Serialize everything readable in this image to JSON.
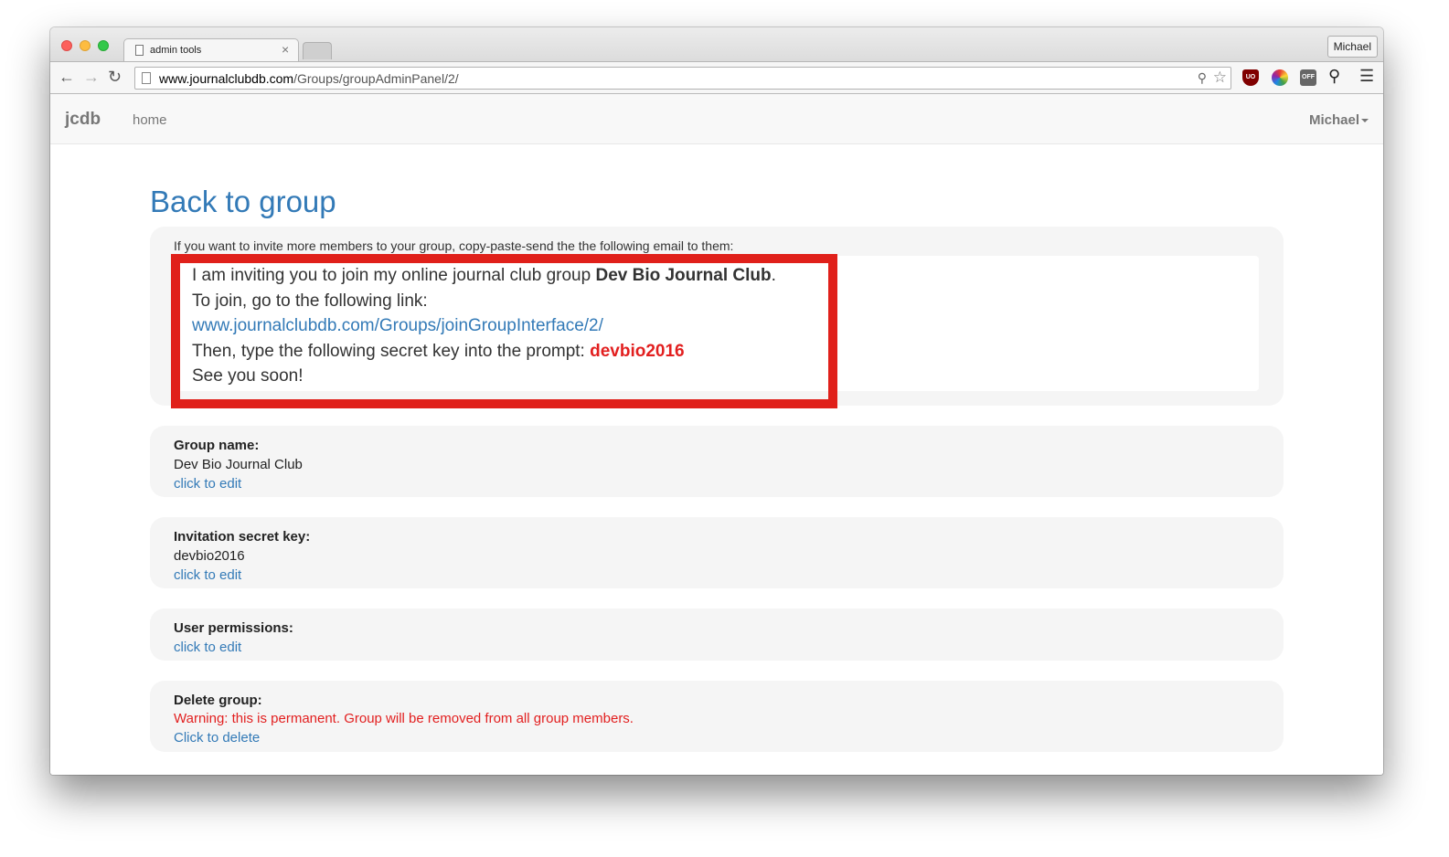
{
  "browser": {
    "tab_title": "admin tools",
    "tab_close": "×",
    "profile_name": "Michael",
    "url_host": "www.journalclubdb.com",
    "url_path": "/Groups/groupAdminPanel/2/",
    "ext_ublock_label": "UO",
    "ext_off_label": "OFF"
  },
  "navbar": {
    "brand": "jcdb",
    "home": "home",
    "user": "Michael"
  },
  "main": {
    "back_link": "Back to group",
    "invite": {
      "intro": "If you want to invite more members to your group, copy-paste-send the the following email to them:",
      "line1_prefix": "I am inviting you to join my online journal club group ",
      "group_name": "Dev Bio Journal Club",
      "line1_suffix": ".",
      "line2": "To join, go to the following link:",
      "link": "www.journalclubdb.com/Groups/joinGroupInterface/2/",
      "line4_prefix": "Then, type the following secret key into the prompt: ",
      "secret_key": "devbio2016",
      "line5": "See you soon!"
    },
    "group_name": {
      "title": "Group name:",
      "value": "Dev Bio Journal Club",
      "edit": "click to edit"
    },
    "secret_key": {
      "title": "Invitation secret key:",
      "value": "devbio2016",
      "edit": "click to edit"
    },
    "permissions": {
      "title": "User permissions:",
      "edit": "click to edit"
    },
    "delete_group": {
      "title": "Delete group:",
      "warning": "Warning: this is permanent. Group will be removed from all group members.",
      "action": "Click to delete"
    }
  },
  "colors": {
    "link": "#337ab7",
    "warning": "#e21f1f",
    "highlight_border": "#e0201a"
  }
}
